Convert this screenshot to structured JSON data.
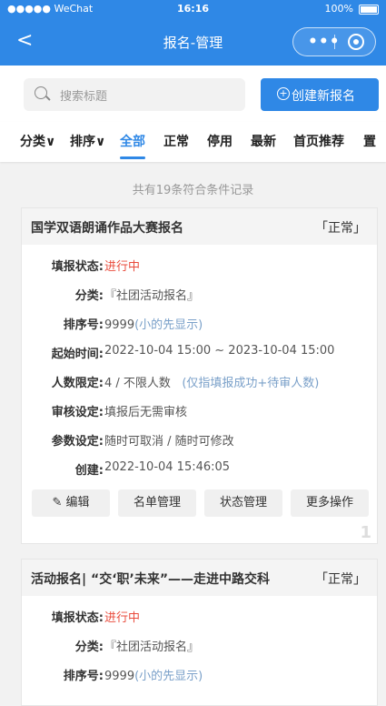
{
  "status": {
    "carrier": "●●●●● WeChat",
    "time": "16:16",
    "battery": "100%"
  },
  "nav": {
    "title": "报名-管理",
    "back_icon": "chevron-left-icon",
    "menu_dots": "•••"
  },
  "search": {
    "placeholder": "搜索标题",
    "create_label": "创建新报名",
    "create_icon": "+"
  },
  "tabs": [
    "分类∨",
    "排序∨",
    "全部",
    "正常",
    "停用",
    "最新",
    "首页推荐",
    "置"
  ],
  "count_text": "共有19条符合条件记录",
  "labels": {
    "fill_status": "填报状态:",
    "category": "分类:",
    "sort": "排序号:",
    "start": "起始时间:",
    "limit": "人数限定:",
    "audit": "审核设定:",
    "params": "参数设定:",
    "created": "创建:"
  },
  "cards": [
    {
      "title": "国学双语朗诵作品大赛报名",
      "status": "「正常」",
      "fill_status": "进行中",
      "category": "『社团活动报名』",
      "sort_no": "9999",
      "sort_hint": "(小的先显示)",
      "start_time": "2022-10-04 15:00 ~ 2023-10-04 15:00",
      "limit": "4 / 不限人数",
      "limit_hint": "(仅指填报成功+待审人数)",
      "audit": "填报后无需审核",
      "params": "随时可取消  /  随时可修改",
      "created": "2022-10-04 15:46:05",
      "index": "1"
    },
    {
      "title": "活动报名| “交‘职’未来”——走进中路交科",
      "status": "「正常」",
      "fill_status": "进行中",
      "category": "『社团活动报名』",
      "sort_no": "9999",
      "sort_hint": "(小的先显示)"
    }
  ],
  "actions": {
    "edit": "编辑",
    "list": "名单管理",
    "state": "状态管理",
    "more": "更多操作"
  }
}
